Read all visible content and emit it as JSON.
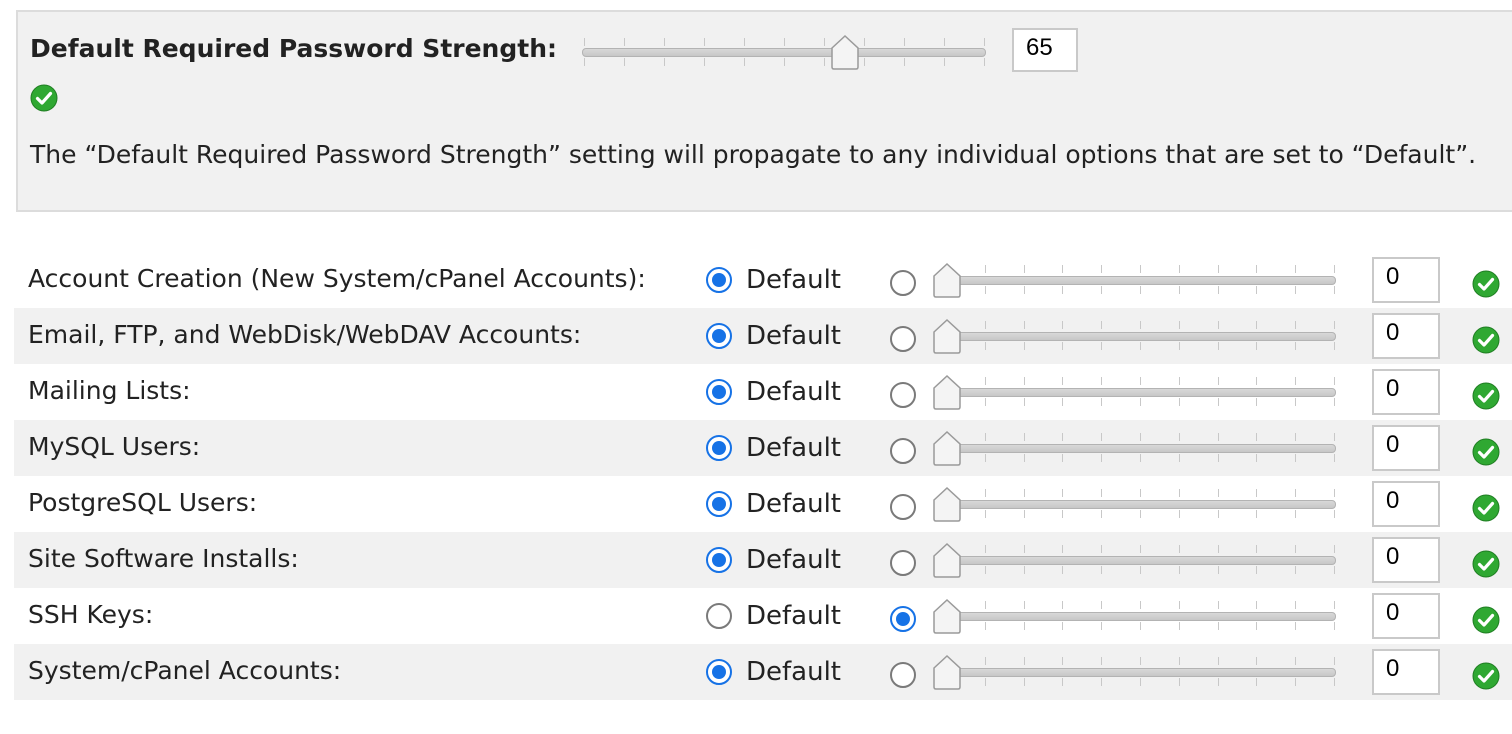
{
  "header": {
    "title": "Default Required Password Strength:",
    "strength_value": "65",
    "strength_level": 65,
    "note": "The “Default Required Password Strength” setting will propagate to any individual options that are set to “Default”."
  },
  "radio_default_label": "Default",
  "rows": [
    {
      "label": "Account Creation (New System/cPanel Accounts):",
      "value": "0",
      "mode": "default"
    },
    {
      "label": "Email, FTP, and WebDisk/WebDAV Accounts:",
      "value": "0",
      "mode": "default"
    },
    {
      "label": "Mailing Lists:",
      "value": "0",
      "mode": "default"
    },
    {
      "label": "MySQL Users:",
      "value": "0",
      "mode": "default"
    },
    {
      "label": "PostgreSQL Users:",
      "value": "0",
      "mode": "default"
    },
    {
      "label": "Site Software Installs:",
      "value": "0",
      "mode": "default"
    },
    {
      "label": "SSH Keys:",
      "value": "0",
      "mode": "custom"
    },
    {
      "label": "System/cPanel Accounts:",
      "value": "0",
      "mode": "default"
    }
  ],
  "colors": {
    "accent": "#1672e6",
    "ok_green": "#2fa832",
    "panel_bg": "#f1f1f1"
  },
  "icons": {
    "valid": "check-circle-icon"
  }
}
